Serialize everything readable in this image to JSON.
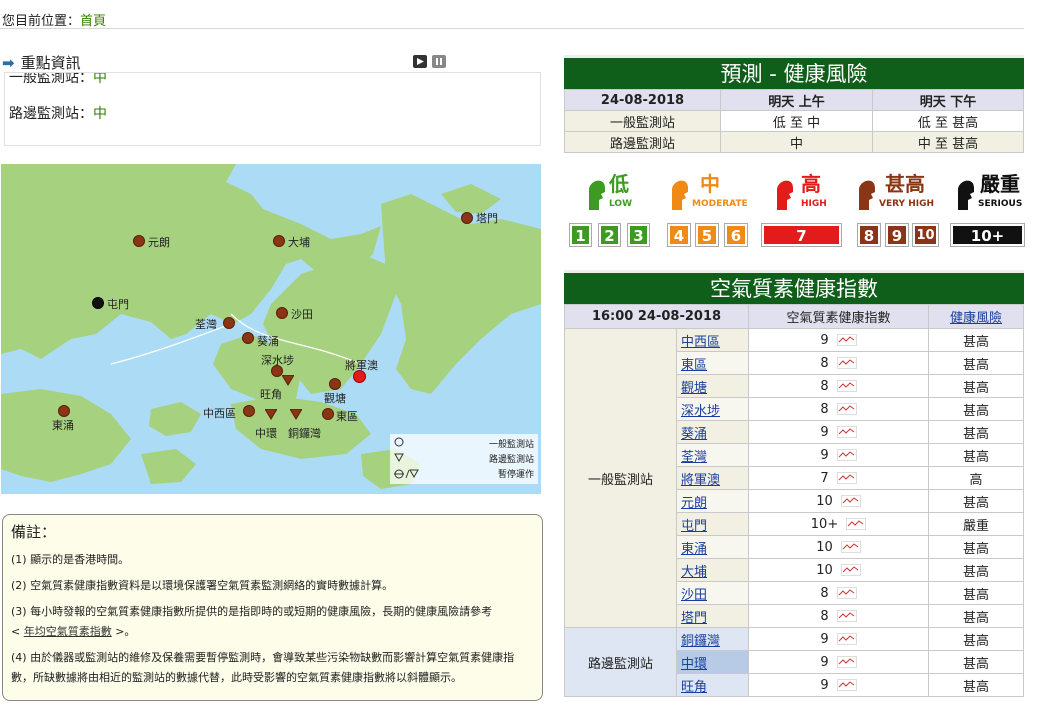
{
  "breadcrumb": {
    "label": "您目前位置：",
    "current": "首頁"
  },
  "news": {
    "title": "重點資訊",
    "rows": [
      {
        "label": "一般監測站：",
        "value": "中"
      },
      {
        "label": "路邊監測站：",
        "value": "中"
      }
    ]
  },
  "map": {
    "stations": [
      {
        "name": "塔門",
        "type": "general",
        "status": "very_high"
      },
      {
        "name": "元朗",
        "type": "general",
        "status": "very_high"
      },
      {
        "name": "大埔",
        "type": "general",
        "status": "very_high"
      },
      {
        "name": "屯門",
        "type": "general",
        "status": "serious"
      },
      {
        "name": "荃灣",
        "type": "general",
        "status": "very_high"
      },
      {
        "name": "沙田",
        "type": "general",
        "status": "very_high"
      },
      {
        "name": "葵涌",
        "type": "general",
        "status": "very_high"
      },
      {
        "name": "深水埗",
        "type": "general",
        "status": "very_high"
      },
      {
        "name": "將軍澳",
        "type": "general",
        "status": "high"
      },
      {
        "name": "旺角",
        "type": "roadside",
        "status": "very_high"
      },
      {
        "name": "觀塘",
        "type": "general",
        "status": "very_high"
      },
      {
        "name": "東涌",
        "type": "general",
        "status": "very_high"
      },
      {
        "name": "中西區",
        "type": "general",
        "status": "very_high"
      },
      {
        "name": "東區",
        "type": "general",
        "status": "very_high"
      },
      {
        "name": "中環",
        "type": "roadside",
        "status": "very_high"
      },
      {
        "name": "銅鑼灣",
        "type": "roadside",
        "status": "very_high"
      }
    ],
    "legend": {
      "general": "一般監測站",
      "roadside": "路邊監測站",
      "suspended": "暫停運作"
    }
  },
  "remarks": {
    "title": "備註：",
    "notes": [
      "(1) 顯示的是香港時間。",
      "(2) 空氣質素健康指數資料是以環境保護署空氣質素監測網絡的實時數據計算。",
      "(3) 每小時發報的空氣質素健康指數所提供的是指即時的或短期的健康風險，長期的健康風險請參考",
      "(4) 由於儀器或監測站的維修及保養需要暫停監測時，會導致某些污染物缺數而影響計算空氣質素健康指數，所缺數據將由相近的監測站的數據代替，此時受影響的空氣質素健康指數將以斜體顯示。"
    ],
    "note3_link_pre": "< ",
    "note3_link": "年均空氣質素指數",
    "note3_link_post": " >。"
  },
  "forecast": {
    "title": "預測 - 健康風險",
    "date": "24-08-2018",
    "col1": "明天 上午",
    "col2": "明天 下午",
    "rows": [
      {
        "label": "一般監測站",
        "am": "低 至 中",
        "pm": "低 至 甚高"
      },
      {
        "label": "路邊監測站",
        "am": "中",
        "pm": "中 至 甚高"
      }
    ]
  },
  "risk_legend": {
    "categories": [
      {
        "zh": "低",
        "en": "LOW",
        "color": "#3d9b22",
        "nums": [
          "1",
          "2",
          "3"
        ]
      },
      {
        "zh": "中",
        "en": "MODERATE",
        "color": "#f08a16",
        "nums": [
          "4",
          "5",
          "6"
        ]
      },
      {
        "zh": "高",
        "en": "HIGH",
        "color": "#e21b1b",
        "nums": [
          "7"
        ]
      },
      {
        "zh": "甚高",
        "en": "VERY HIGH",
        "color": "#8a3515",
        "nums": [
          "8",
          "9",
          "10"
        ]
      },
      {
        "zh": "嚴重",
        "en": "SERIOUS",
        "color": "#111111",
        "nums": [
          "10+"
        ]
      }
    ]
  },
  "aqhi": {
    "title": "空氣質素健康指數",
    "time": "16:00 24-08-2018",
    "col_index": "空氣質素健康指數",
    "col_risk": "健康風險",
    "groups": [
      {
        "name": "一般監測站",
        "stations": [
          {
            "name": "中西區",
            "index": "9",
            "risk": "甚高"
          },
          {
            "name": "東區",
            "index": "8",
            "risk": "甚高"
          },
          {
            "name": "觀塘",
            "index": "8",
            "risk": "甚高"
          },
          {
            "name": "深水埗",
            "index": "8",
            "risk": "甚高"
          },
          {
            "name": "葵涌",
            "index": "9",
            "risk": "甚高"
          },
          {
            "name": "荃灣",
            "index": "9",
            "risk": "甚高"
          },
          {
            "name": "將軍澳",
            "index": "7",
            "risk": "高"
          },
          {
            "name": "元朗",
            "index": "10",
            "risk": "甚高"
          },
          {
            "name": "屯門",
            "index": "10+",
            "risk": "嚴重"
          },
          {
            "name": "東涌",
            "index": "10",
            "risk": "甚高"
          },
          {
            "name": "大埔",
            "index": "10",
            "risk": "甚高"
          },
          {
            "name": "沙田",
            "index": "8",
            "risk": "甚高"
          },
          {
            "name": "塔門",
            "index": "8",
            "risk": "甚高"
          }
        ]
      },
      {
        "name": "路邊監測站",
        "stations": [
          {
            "name": "銅鑼灣",
            "index": "9",
            "risk": "甚高"
          },
          {
            "name": "中環",
            "index": "9",
            "risk": "甚高"
          },
          {
            "name": "旺角",
            "index": "9",
            "risk": "甚高"
          }
        ]
      }
    ]
  },
  "colors": {
    "brand_green": "#0f5e19",
    "very_high": "#8a3515",
    "high": "#e21b1b",
    "serious": "#111111"
  }
}
